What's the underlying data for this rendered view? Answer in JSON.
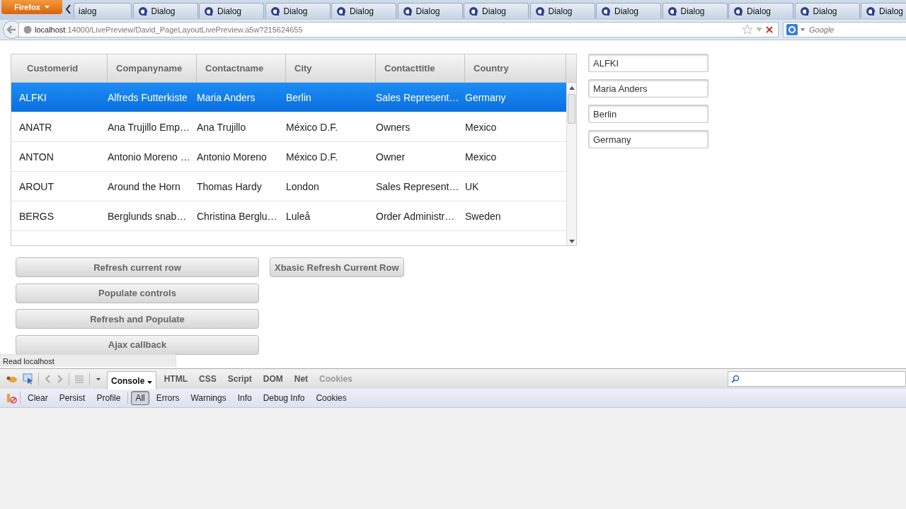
{
  "browser": {
    "menu_button": "Firefox",
    "tabs": [
      {
        "label": "ialog",
        "selected": false
      },
      {
        "label": "Dialog",
        "selected": false
      },
      {
        "label": "Dialog",
        "selected": false
      },
      {
        "label": "Dialog",
        "selected": false
      },
      {
        "label": "Dialog",
        "selected": false
      },
      {
        "label": "Dialog",
        "selected": false
      },
      {
        "label": "Dialog",
        "selected": false
      },
      {
        "label": "Dialog",
        "selected": false
      },
      {
        "label": "Dialog",
        "selected": false
      },
      {
        "label": "Dialog",
        "selected": false
      },
      {
        "label": "Dialog",
        "selected": false
      },
      {
        "label": "Dialog",
        "selected": false
      },
      {
        "label": "Dialog",
        "selected": false
      }
    ],
    "url": {
      "host": "localhost",
      "rest": ":14000/LivePreview/David_PageLayoutLivePreview.a5w?215624655"
    },
    "search": {
      "placeholder": "Google"
    }
  },
  "grid": {
    "columns": [
      "Customerid",
      "Companyname",
      "Contactname",
      "City",
      "Contacttitle",
      "Country"
    ],
    "rows": [
      {
        "selected": true,
        "cells": [
          "ALFKI",
          "Alfreds Futterkiste",
          "Maria Anders",
          "Berlin",
          "Sales Represent…",
          "Germany"
        ]
      },
      {
        "selected": false,
        "cells": [
          "ANATR",
          "Ana Trujillo Emp…",
          "Ana Trujillo",
          "México D.F.",
          "Owners",
          "Mexico"
        ]
      },
      {
        "selected": false,
        "cells": [
          "ANTON",
          "Antonio Moreno …",
          "Antonio Moreno",
          "México D.F.",
          "Owner",
          "Mexico"
        ]
      },
      {
        "selected": false,
        "cells": [
          "AROUT",
          "Around the Horn",
          "Thomas Hardy",
          "London",
          "Sales Represent…",
          "UK"
        ]
      },
      {
        "selected": false,
        "cells": [
          "BERGS",
          "Berglunds snab…",
          "Christina Berglu…",
          "Luleå",
          "Order Administr…",
          "Sweden"
        ]
      }
    ]
  },
  "fields": [
    {
      "value": "ALFKI"
    },
    {
      "value": "Maria Anders"
    },
    {
      "value": "Berlin"
    },
    {
      "value": "Germany"
    }
  ],
  "buttons": [
    {
      "label": "Refresh current row"
    },
    {
      "label": "Populate controls"
    },
    {
      "label": "Refresh and Populate"
    },
    {
      "label": "Ajax callback"
    }
  ],
  "side_button": {
    "label": "Xbasic Refresh Current Row"
  },
  "status_text": "Read localhost",
  "firebug": {
    "panels": [
      {
        "label": "Console",
        "selected": true,
        "disabled": false
      },
      {
        "label": "HTML",
        "selected": false,
        "disabled": false
      },
      {
        "label": "CSS",
        "selected": false,
        "disabled": false
      },
      {
        "label": "Script",
        "selected": false,
        "disabled": false
      },
      {
        "label": "DOM",
        "selected": false,
        "disabled": false
      },
      {
        "label": "Net",
        "selected": false,
        "disabled": false
      },
      {
        "label": "Cookies",
        "selected": false,
        "disabled": true
      }
    ],
    "actions": [
      "Clear",
      "Persist",
      "Profile"
    ],
    "filters": [
      {
        "label": "All",
        "selected": true
      },
      {
        "label": "Errors",
        "selected": false
      },
      {
        "label": "Warnings",
        "selected": false
      },
      {
        "label": "Info",
        "selected": false
      },
      {
        "label": "Debug Info",
        "selected": false
      },
      {
        "label": "Cookies",
        "selected": false
      }
    ]
  }
}
